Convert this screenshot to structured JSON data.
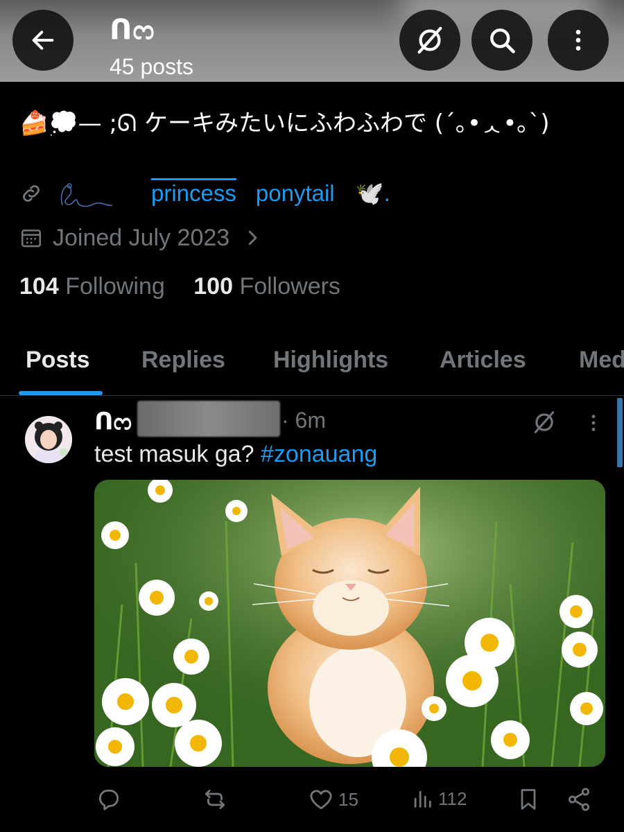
{
  "header": {
    "name": "ᑎᦂ",
    "posts_count": "45 posts"
  },
  "profile": {
    "bio": "🍰💭—  ;ᘏ ケーキみたいにふわふわで (´｡•ᆺ•｡`)",
    "link_text": "princess",
    "link_text_2": "ponytail",
    "link_suffix": "🕊️.",
    "joined": "Joined July 2023",
    "following_count": "104",
    "following_label": "Following",
    "followers_count": "100",
    "followers_label": "Followers"
  },
  "tabs": [
    {
      "label": "Posts",
      "active": true
    },
    {
      "label": "Replies"
    },
    {
      "label": "Highlights"
    },
    {
      "label": "Articles"
    },
    {
      "label": "Media"
    }
  ],
  "post": {
    "author": "ᑎᦂ",
    "time": "· 6m",
    "text": "test masuk ga?",
    "hashtag": "#zonauang",
    "media_description": "orange kitten with closed eyes sitting among white daisies in green grass",
    "replies": "",
    "reposts": "",
    "likes": "15",
    "views": "112"
  },
  "colors": {
    "background": "#000000",
    "text": "#e7e9ea",
    "muted": "#71767b",
    "accent": "#1d9bf0",
    "divider": "#2f3336"
  },
  "icons": [
    "back-arrow-icon",
    "no-grok-icon",
    "search-icon",
    "more-vertical-icon",
    "link-icon",
    "calendar-icon",
    "chevron-right-icon",
    "reply-icon",
    "repost-icon",
    "like-icon",
    "views-icon",
    "bookmark-icon",
    "share-icon"
  ]
}
